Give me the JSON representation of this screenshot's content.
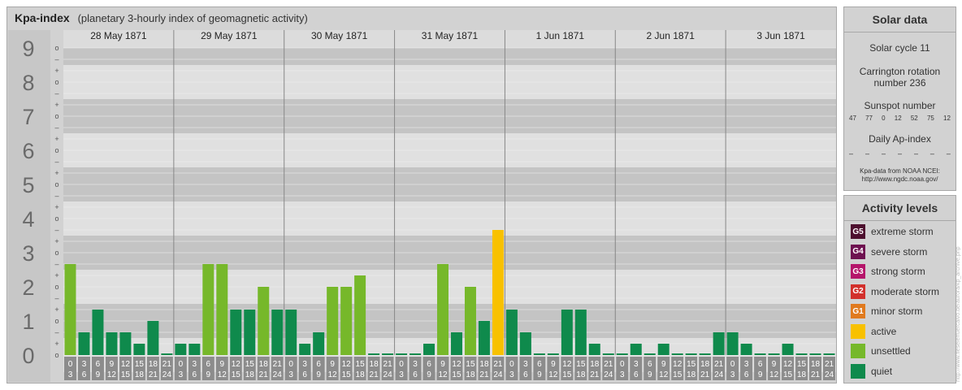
{
  "header": {
    "title": "Kpa-index",
    "subtitle": "(planetary 3-hourly index of geomagnetic activity)"
  },
  "chart_data": {
    "type": "bar",
    "title": "Kpa-index",
    "subtitle": "(planetary 3-hourly index of geomagnetic activity)",
    "ylim": [
      0,
      9
    ],
    "y_ticks": [
      "0",
      "1",
      "2",
      "3",
      "4",
      "5",
      "6",
      "7",
      "8",
      "9"
    ],
    "minor_ticks": [
      "o",
      "+",
      "–"
    ],
    "days": [
      "28 May 1871",
      "29 May 1871",
      "30 May 1871",
      "31 May 1871",
      "1 Jun 1871",
      "2 Jun 1871",
      "3 Jun 1871"
    ],
    "interval_labels": [
      [
        "0",
        "3"
      ],
      [
        "3",
        "6"
      ],
      [
        "6",
        "9"
      ],
      [
        "9",
        "12"
      ],
      [
        "12",
        "15"
      ],
      [
        "15",
        "18"
      ],
      [
        "18",
        "21"
      ],
      [
        "21",
        "24"
      ]
    ],
    "values": [
      [
        2.667,
        0.667,
        1.333,
        0.667,
        0.667,
        0.333,
        1.0,
        0.0
      ],
      [
        0.333,
        0.333,
        2.667,
        2.667,
        1.333,
        1.333,
        2.0,
        1.333
      ],
      [
        1.333,
        0.333,
        0.667,
        2.0,
        2.0,
        2.333,
        0.0,
        0.0
      ],
      [
        0.0,
        0.0,
        0.333,
        2.667,
        0.667,
        2.0,
        1.0,
        3.667
      ],
      [
        1.333,
        0.667,
        0.0,
        0.0,
        1.333,
        1.333,
        0.333,
        0.0
      ],
      [
        0.0,
        0.333,
        0.0,
        0.333,
        0.0,
        0.0,
        0.0,
        0.667
      ],
      [
        0.667,
        0.333,
        0.0,
        0.0,
        0.333,
        0.0,
        0.0,
        0.0
      ]
    ],
    "colors": {
      "quiet": "#0f8a4c",
      "unsettled": "#76b82a",
      "active": "#f8c100"
    },
    "grid": true
  },
  "solar": {
    "title": "Solar data",
    "cycle": "Solar cycle 11",
    "carrington_1": "Carrington rotation",
    "carrington_2": "number 236",
    "sunspot_title": "Sunspot number",
    "sunspots": [
      "47",
      "77",
      "0",
      "12",
      "52",
      "75",
      "12"
    ],
    "ap_title": "Daily Ap-index",
    "ap_values": [
      "–",
      "–",
      "–",
      "–",
      "–",
      "–",
      "–"
    ],
    "source_1": "Kpa-data from NOAA NCEI:",
    "source_2": "http://www.ngdc.noaa.gov/"
  },
  "levels": {
    "title": "Activity levels",
    "items": [
      {
        "code": "G5",
        "label": "extreme storm",
        "color": "#4d0f2e"
      },
      {
        "code": "G4",
        "label": "severe storm",
        "color": "#6e1150"
      },
      {
        "code": "G3",
        "label": "strong storm",
        "color": "#b5156a"
      },
      {
        "code": "G2",
        "label": "moderate storm",
        "color": "#d2302c"
      },
      {
        "code": "G1",
        "label": "minor storm",
        "color": "#e07a1e"
      },
      {
        "code": "",
        "label": "active",
        "color": "#f8c100"
      },
      {
        "code": "",
        "label": "unsettled",
        "color": "#76b82a"
      },
      {
        "code": "",
        "label": "quiet",
        "color": "#0f8a4c"
      }
    ]
  },
  "credit": "http://www.fieselerfuercalvo.de/aurora/kp_archive.php"
}
